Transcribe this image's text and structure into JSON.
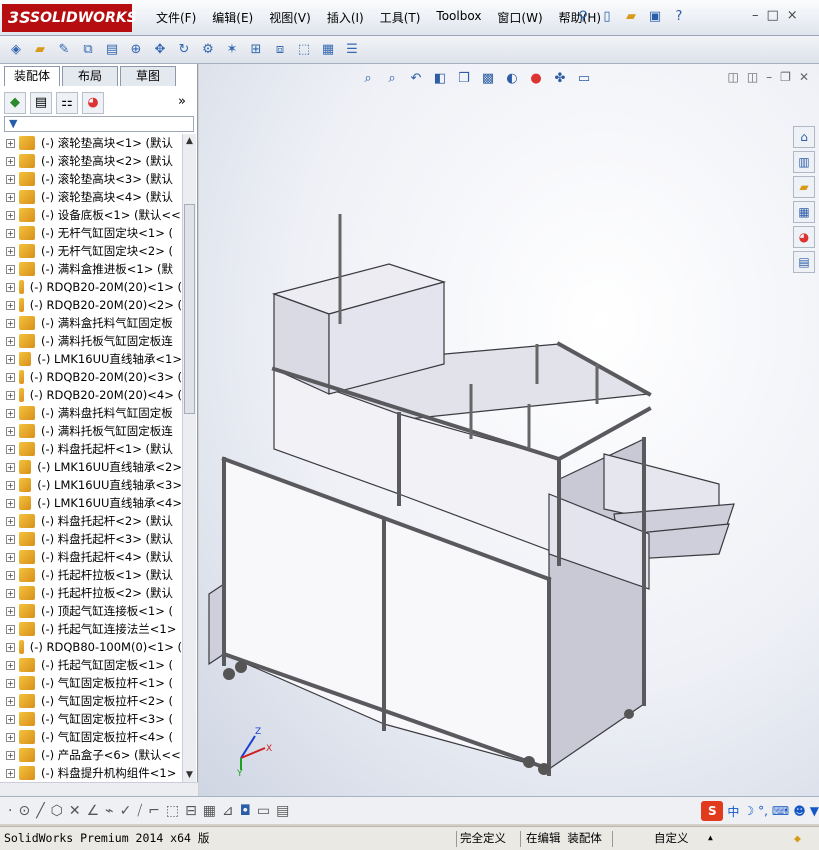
{
  "app": {
    "logo_text": "SOLIDWORKS",
    "logo_prefix": "3S"
  },
  "menu": [
    "文件(F)",
    "编辑(E)",
    "视图(V)",
    "插入(I)",
    "工具(T)",
    "Toolbox",
    "窗口(W)",
    "帮助(H)"
  ],
  "title_icons": {
    "pin": "pin-icon",
    "new": "new-doc-icon",
    "open": "open-folder-icon",
    "save": "save-icon",
    "help": "?"
  },
  "window_controls": [
    "–",
    "□",
    "×"
  ],
  "panel_tabs": [
    "装配体",
    "布局",
    "草图"
  ],
  "panel_chevron": "»",
  "filter_symbol": "▼",
  "tree_items": [
    "(-) 滚轮垫高块<1> (默认",
    "(-) 滚轮垫高块<2> (默认",
    "(-) 滚轮垫高块<3> (默认",
    "(-) 滚轮垫高块<4> (默认",
    "(-) 设备底板<1> (默认<<",
    "(-) 无杆气缸固定块<1> (",
    "(-) 无杆气缸固定块<2> (",
    "(-) 满料盒推进板<1> (默",
    "(-) RDQB20-20M(20)<1> (",
    "(-) RDQB20-20M(20)<2> (",
    "(-) 满料盒托料气缸固定板",
    "(-) 满料托板气缸固定板连",
    "(-) LMK16UU直线轴承<1>",
    "(-) RDQB20-20M(20)<3> (",
    "(-) RDQB20-20M(20)<4> (",
    "(-) 满料盘托料气缸固定板",
    "(-) 满料托板气缸固定板连",
    "(-) 料盘托起杆<1> (默认",
    "(-) LMK16UU直线轴承<2>",
    "(-) LMK16UU直线轴承<3>",
    "(-) LMK16UU直线轴承<4>",
    "(-) 料盘托起杆<2> (默认",
    "(-) 料盘托起杆<3> (默认",
    "(-) 料盘托起杆<4> (默认",
    "(-) 托起杆拉板<1> (默认",
    "(-) 托起杆拉板<2> (默认",
    "(-) 顶起气缸连接板<1> (",
    "(-) 托起气缸连接法兰<1>",
    "(-) RDQB80-100M(0)<1> (",
    "(-) 托起气缸固定板<1> (",
    "(-) 气缸固定板拉杆<1> (",
    "(-) 气缸固定板拉杆<2> (",
    "(-) 气缸固定板拉杆<3> (",
    "(-) 气缸固定板拉杆<4> (",
    "(-) 产品盒子<6> (默认<<",
    "(-) 料盘提升机构组件<1>"
  ],
  "triad": {
    "x": "X",
    "y": "Y",
    "z": "Z"
  },
  "ime": {
    "logo": "S",
    "lang": "中",
    "moon": "☽",
    "punct": "°,"
  },
  "status": {
    "version": "SolidWorks Premium 2014 x64 版",
    "state": "完全定义",
    "mode": "在编辑 装配体",
    "units": "自定义",
    "caret": "▲"
  },
  "colors": {
    "brand": "#b50d10",
    "frame": "#5a5a5e",
    "panel": "#dcdce6",
    "window": "#c9c9d6"
  }
}
